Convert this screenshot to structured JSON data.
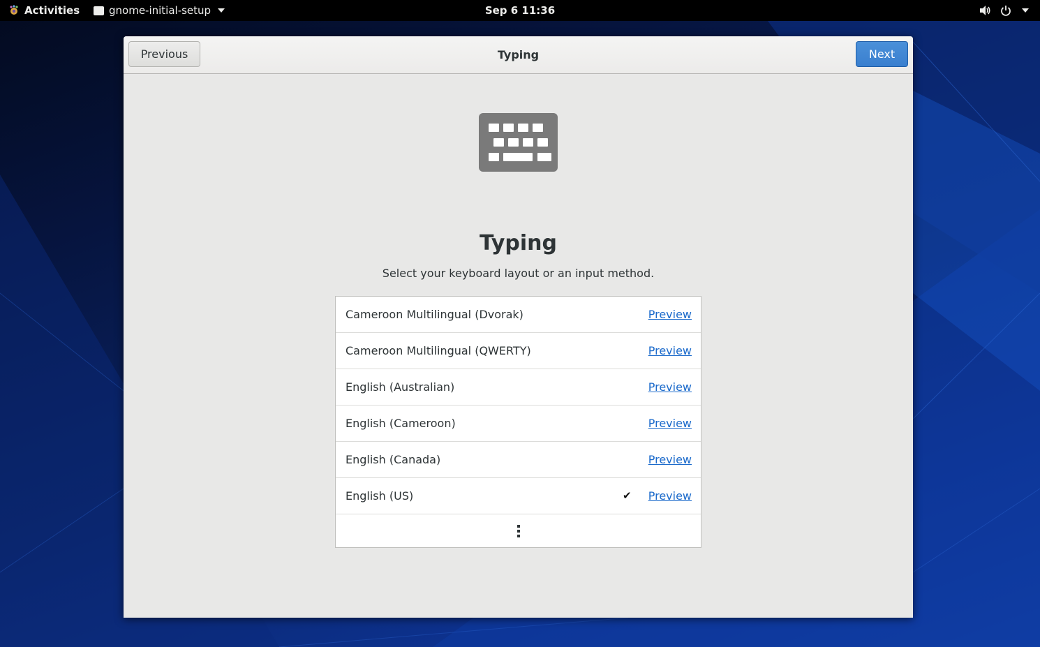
{
  "topbar": {
    "activities_label": "Activities",
    "app_name": "gnome-initial-setup",
    "clock": "Sep 6  11:36",
    "icons": [
      "volume-icon",
      "power-icon",
      "system-menu-arrow-icon"
    ]
  },
  "window": {
    "header_title": "Typing",
    "previous_label": "Previous",
    "next_label": "Next"
  },
  "page": {
    "icon": "keyboard-icon",
    "title": "Typing",
    "subtitle": "Select your keyboard layout or an input method."
  },
  "layouts": [
    {
      "label": "Cameroon Multilingual (Dvorak)",
      "preview": "Preview",
      "selected": false
    },
    {
      "label": "Cameroon Multilingual (QWERTY)",
      "preview": "Preview",
      "selected": false
    },
    {
      "label": "English (Australian)",
      "preview": "Preview",
      "selected": false
    },
    {
      "label": "English (Cameroon)",
      "preview": "Preview",
      "selected": false
    },
    {
      "label": "English (Canada)",
      "preview": "Preview",
      "selected": false
    },
    {
      "label": "English (US)",
      "preview": "Preview",
      "selected": true,
      "check": "✔"
    }
  ],
  "colors": {
    "accent": "#3a7fcf",
    "link": "#1b6acb",
    "window_bg": "#e8e8e7",
    "topbar_bg": "#000000"
  }
}
